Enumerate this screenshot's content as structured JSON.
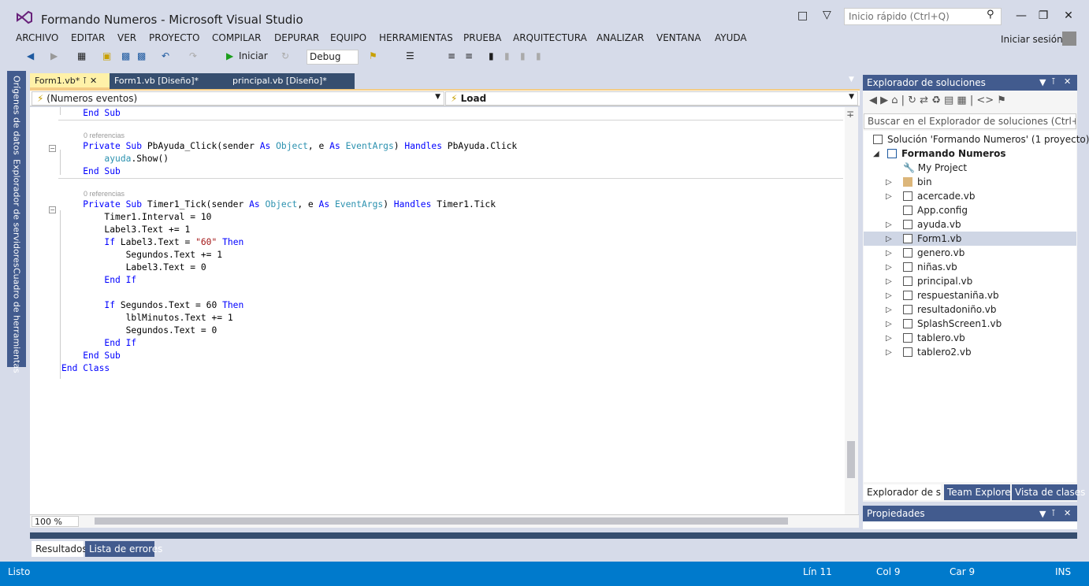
{
  "window": {
    "title": "Formando Numeros - Microsoft Visual Studio",
    "quick_launch_placeholder": "Inicio rápido (Ctrl+Q)",
    "signin": "Iniciar sesión"
  },
  "menu": [
    "ARCHIVO",
    "EDITAR",
    "VER",
    "PROYECTO",
    "COMPILAR",
    "DEPURAR",
    "EQUIPO",
    "HERRAMIENTAS",
    "PRUEBA",
    "ARQUITECTURA",
    "ANALIZAR",
    "VENTANA",
    "AYUDA"
  ],
  "toolbar": {
    "start": "Iniciar",
    "config": "Debug"
  },
  "left_tabs": [
    "Orígenes de datos",
    "Explorador de servidores",
    "Cuadro de herramientas"
  ],
  "doc_tabs": [
    "Form1.vb*",
    "Form1.vb [Diseño]*",
    "principal.vb [Diseño]*"
  ],
  "nav": {
    "left": "(Numeros eventos)",
    "right": "Load"
  },
  "code": {
    "l1": "        End Sub",
    "ref1": "0 referencias",
    "l2a": "Private Sub PbAyuda_Click(sender ",
    "l3": "ayuda",
    "l3b": ".Show()",
    "l4": "End Sub",
    "ref2": "0 referencias",
    "l5": "Timer1_Tick(sender ",
    "l5b": " Handles Timer1.Tick",
    "l6": "Timer1.Interval = 10",
    "l7": "Label3.Text += 1",
    "l8": "Label3.Text = ",
    "l8s": "\"60\"",
    "l9": "Segundos.Text += 1",
    "l10": "Label3.Text = 0",
    "l11": "Segundos.Text = 60 ",
    "l12": "lblMinutos.Text += 1",
    "l13": "Segundos.Text = 0"
  },
  "zoom": "100 %",
  "bottom_tabs": [
    "Resultados",
    "Lista de errores"
  ],
  "status": {
    "left": "Listo",
    "line": "Lín 11",
    "col": "Col 9",
    "car": "Car 9",
    "mode": "INS"
  },
  "solution_explorer": {
    "title": "Explorador de soluciones",
    "search_placeholder": "Buscar en el Explorador de soluciones (Ctrl+",
    "solution": "Solución 'Formando Numeros'  (1 proyecto)",
    "project": "Formando Numeros",
    "items": [
      "My Project",
      "bin",
      "acercade.vb",
      "App.config",
      "ayuda.vb",
      "Form1.vb",
      "genero.vb",
      "niñas.vb",
      "principal.vb",
      "respuestaniña.vb",
      "resultadoniño.vb",
      "SplashScreen1.vb",
      "tablero.vb",
      "tablero2.vb"
    ],
    "tabs": [
      "Explorador de s...",
      "Team Explorer",
      "Vista de clases"
    ]
  },
  "properties": {
    "title": "Propiedades"
  }
}
